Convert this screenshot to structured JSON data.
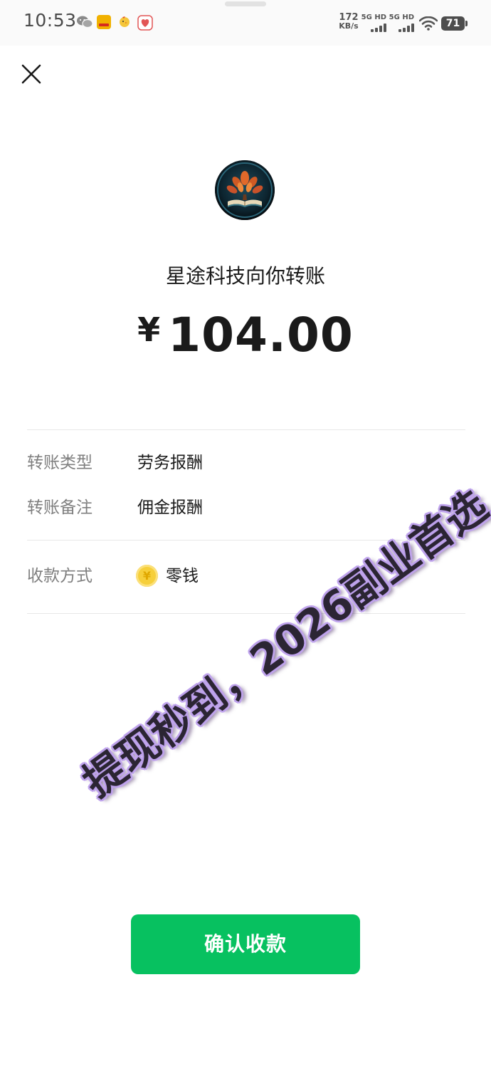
{
  "status_bar": {
    "time": "10:53",
    "net_speed_value": "172",
    "net_speed_unit": "KB/s",
    "signal_1_label": "5G HD",
    "signal_2_label": "5G HD",
    "battery_level": "71",
    "notification_icons": [
      "wechat-icon",
      "app-icon",
      "chick-icon",
      "heart-app-icon"
    ]
  },
  "header": {
    "close_icon": "close-icon"
  },
  "transfer": {
    "title": "星途科技向你转账",
    "currency_symbol": "¥",
    "amount": "104.00"
  },
  "details": {
    "type_label": "转账类型",
    "type_value": "劳务报酬",
    "note_label": "转账备注",
    "note_value": "佣金报酬",
    "method_label": "收款方式",
    "method_value": "零钱",
    "method_icon": "coin-icon",
    "coin_glyph": "¥"
  },
  "watermark": {
    "text": "提现秒到，2026副业首选"
  },
  "actions": {
    "confirm_label": "确认收款"
  },
  "colors": {
    "accent_green": "#07c160",
    "label_gray": "#7f7f7f",
    "watermark_glow": "#c2a7ee"
  }
}
